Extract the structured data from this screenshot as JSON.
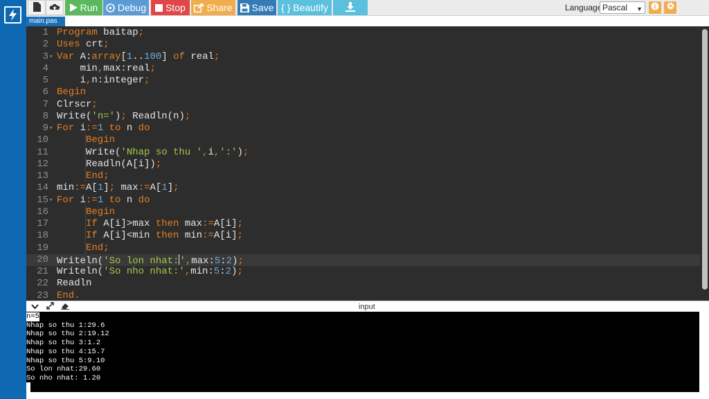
{
  "toolbar": {
    "run_label": "Run",
    "debug_label": "Debug",
    "stop_label": "Stop",
    "share_label": "Share",
    "save_label": "Save",
    "beautify_label": "{ } Beautify",
    "language_label": "Language",
    "language_value": "Pascal"
  },
  "file_tab": {
    "name": "main.pas"
  },
  "editor": {
    "active_line": 20,
    "lines": [
      {
        "n": 1,
        "t": [
          [
            "kw",
            "Program "
          ],
          [
            "id",
            "baitap"
          ],
          [
            "op",
            ";"
          ]
        ]
      },
      {
        "n": 2,
        "t": [
          [
            "kw",
            "Uses "
          ],
          [
            "id",
            "crt"
          ],
          [
            "op",
            ";"
          ]
        ]
      },
      {
        "n": 3,
        "fold": true,
        "t": [
          [
            "kw",
            "Var "
          ],
          [
            "id",
            "A:"
          ],
          [
            "kw",
            "array"
          ],
          [
            "id",
            "["
          ],
          [
            "num",
            "1"
          ],
          [
            "id",
            ".."
          ],
          [
            "num",
            "100"
          ],
          [
            "id",
            "] "
          ],
          [
            "kw",
            "of "
          ],
          [
            "id",
            "real"
          ],
          [
            "op",
            ";"
          ]
        ]
      },
      {
        "n": 4,
        "t": [
          [
            "id",
            "    min"
          ],
          [
            "op",
            ","
          ],
          [
            "id",
            "max:real"
          ],
          [
            "op",
            ";"
          ]
        ]
      },
      {
        "n": 5,
        "t": [
          [
            "id",
            "    i"
          ],
          [
            "op",
            ","
          ],
          [
            "id",
            "n:integer"
          ],
          [
            "op",
            ";"
          ]
        ]
      },
      {
        "n": 6,
        "t": [
          [
            "kw",
            "Begin"
          ]
        ]
      },
      {
        "n": 7,
        "t": [
          [
            "id",
            "Clrscr"
          ],
          [
            "op",
            ";"
          ]
        ]
      },
      {
        "n": 8,
        "t": [
          [
            "id",
            "Write("
          ],
          [
            "str",
            "'n='"
          ],
          [
            "id",
            ")"
          ],
          [
            "op",
            "; "
          ],
          [
            "id",
            "Readln(n)"
          ],
          [
            "op",
            ";"
          ]
        ]
      },
      {
        "n": 9,
        "fold": true,
        "t": [
          [
            "kw",
            "For "
          ],
          [
            "id",
            "i"
          ],
          [
            "op",
            ":="
          ],
          [
            "num",
            "1 "
          ],
          [
            "kw",
            "to "
          ],
          [
            "id",
            "n "
          ],
          [
            "kw",
            "do"
          ]
        ]
      },
      {
        "n": 10,
        "t": [
          [
            "kw",
            "     Begin"
          ]
        ]
      },
      {
        "n": 11,
        "t": [
          [
            "id",
            "     Write("
          ],
          [
            "str",
            "'Nhap so thu '"
          ],
          [
            "op",
            ","
          ],
          [
            "id",
            "i"
          ],
          [
            "op",
            ","
          ],
          [
            "str",
            "':'"
          ],
          [
            "id",
            ")"
          ],
          [
            "op",
            ";"
          ]
        ]
      },
      {
        "n": 12,
        "t": [
          [
            "id",
            "     Readln(A[i])"
          ],
          [
            "op",
            ";"
          ]
        ]
      },
      {
        "n": 13,
        "t": [
          [
            "kw",
            "     End"
          ],
          [
            "op",
            ";"
          ]
        ]
      },
      {
        "n": 14,
        "t": [
          [
            "id",
            "min"
          ],
          [
            "op",
            ":="
          ],
          [
            "id",
            "A["
          ],
          [
            "num",
            "1"
          ],
          [
            "id",
            "]"
          ],
          [
            "op",
            "; "
          ],
          [
            "id",
            "max"
          ],
          [
            "op",
            ":="
          ],
          [
            "id",
            "A["
          ],
          [
            "num",
            "1"
          ],
          [
            "id",
            "]"
          ],
          [
            "op",
            ";"
          ]
        ]
      },
      {
        "n": 15,
        "fold": true,
        "t": [
          [
            "kw",
            "For "
          ],
          [
            "id",
            "i"
          ],
          [
            "op",
            ":="
          ],
          [
            "num",
            "1 "
          ],
          [
            "kw",
            "to "
          ],
          [
            "id",
            "n "
          ],
          [
            "kw",
            "do"
          ]
        ]
      },
      {
        "n": 16,
        "t": [
          [
            "kw",
            "     Begin"
          ]
        ]
      },
      {
        "n": 17,
        "t": [
          [
            "kw",
            "     If "
          ],
          [
            "id",
            "A[i]>max "
          ],
          [
            "kw",
            "then "
          ],
          [
            "id",
            "max"
          ],
          [
            "op",
            ":="
          ],
          [
            "id",
            "A[i]"
          ],
          [
            "op",
            ";"
          ]
        ]
      },
      {
        "n": 18,
        "t": [
          [
            "kw",
            "     If "
          ],
          [
            "id",
            "A[i]<min "
          ],
          [
            "kw",
            "then "
          ],
          [
            "id",
            "min"
          ],
          [
            "op",
            ":="
          ],
          [
            "id",
            "A[i]"
          ],
          [
            "op",
            ";"
          ]
        ]
      },
      {
        "n": 19,
        "t": [
          [
            "kw",
            "     End"
          ],
          [
            "op",
            ";"
          ]
        ]
      },
      {
        "n": 20,
        "cursor_after": 2,
        "t": [
          [
            "id",
            "Writeln("
          ],
          [
            "str",
            "'So lon nhat:"
          ],
          [
            "str",
            "'"
          ],
          [
            "op",
            ","
          ],
          [
            "id",
            "max:"
          ],
          [
            "num",
            "5"
          ],
          [
            "id",
            ":"
          ],
          [
            "num",
            "2"
          ],
          [
            "id",
            ")"
          ],
          [
            "op",
            ";"
          ]
        ]
      },
      {
        "n": 21,
        "t": [
          [
            "id",
            "Writeln("
          ],
          [
            "str",
            "'So nho nhat:'"
          ],
          [
            "op",
            ","
          ],
          [
            "id",
            "min:"
          ],
          [
            "num",
            "5"
          ],
          [
            "id",
            ":"
          ],
          [
            "num",
            "2"
          ],
          [
            "id",
            ")"
          ],
          [
            "op",
            ";"
          ]
        ]
      },
      {
        "n": 22,
        "t": [
          [
            "id",
            "Readln"
          ]
        ]
      },
      {
        "n": 23,
        "t": [
          [
            "kw",
            "End"
          ],
          [
            "op",
            "."
          ]
        ]
      }
    ]
  },
  "console": {
    "title": "input",
    "lines": [
      "n=5",
      "Nhap so thu 1:29.6",
      "Nhap so thu 2:19.12",
      "Nhap so thu 3:1.2",
      "Nhap so thu 4:15.7",
      "Nhap so thu 5:9.10",
      "So lon nhat:29.60",
      "So nho nhat: 1.20"
    ]
  },
  "colors": {
    "brand": "#0f68b2",
    "run": "#5cb85c",
    "debug": "#5b9bd5",
    "stop": "#e04848",
    "share": "#f0ad4e",
    "save": "#337ab7",
    "beautify": "#5bc0de",
    "download": "#5bc0de"
  },
  "icons": {
    "brand": "lightning-icon",
    "new": "file-icon",
    "upload": "cloud-upload-icon",
    "run": "play-icon",
    "debug": "debug-icon",
    "stop": "stop-icon",
    "share": "share-icon",
    "save": "floppy-icon",
    "download": "download-icon",
    "info": "info-icon",
    "settings": "gear-icon"
  }
}
